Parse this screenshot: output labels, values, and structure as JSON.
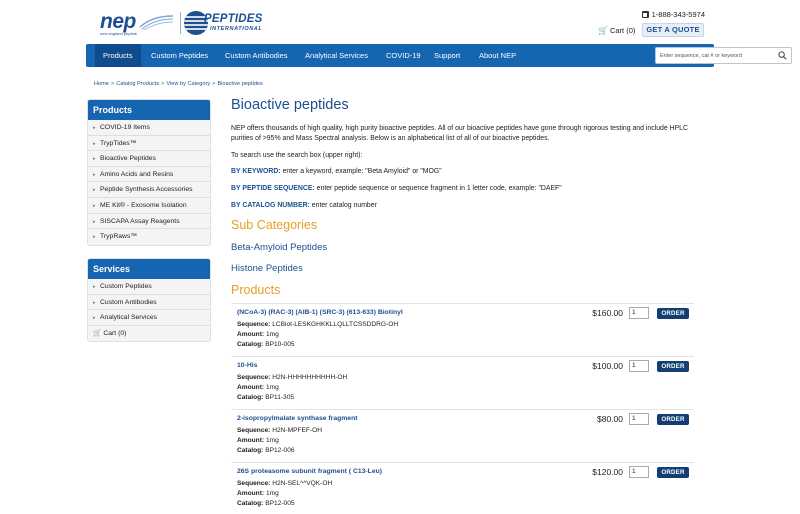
{
  "header": {
    "logo_nep": "nep",
    "logo_nep_sub": "new england peptide",
    "logo_pi": "PEPTIDES",
    "logo_pi_sub": "INTERNATIONAL",
    "phone": "1-888-343-5974",
    "cart": "Cart (0)",
    "quote_button": "GET A QUOTE"
  },
  "nav": {
    "items": [
      "Products",
      "Custom Peptides",
      "Custom Antibodies",
      "Analytical Services",
      "COVID-19",
      "Support",
      "About NEP"
    ],
    "search_placeholder": "Enter sequence, cat # or keyword"
  },
  "breadcrumb": [
    "Home",
    "Catalog Products",
    "View by Category",
    "Bioactive peptides"
  ],
  "sidebar": {
    "products_title": "Products",
    "products_items": [
      "COVID-19 Items",
      "TrypTides™",
      "Bioactive Peptides",
      "Amino Acids and Resins",
      "Peptide Synthesis Accessories",
      "ME Kit® - Exosome Isolation",
      "SISCAPA Assay Reagents",
      "TrypRaws™"
    ],
    "services_title": "Services",
    "services_items": [
      "Custom Peptides",
      "Custom Antibodies",
      "Analytical Services"
    ],
    "cart": "Cart (0)"
  },
  "main": {
    "title": "Bioactive peptides",
    "intro": "NEP offers thousands of high quality, high purity bioactive peptides.  All of our bioactive peptides have gone through rigorous testing and include HPLC purities of >95% and Mass Spectral analysis.  Below is an alphabetical list of all of our bioactive peptides.",
    "search_hint": "To search use the search box (upper right):",
    "hints": [
      {
        "label": "BY KEYWORD:",
        "text": " enter a keyword, example:  \"Beta Amyloid\" or \"MOG\""
      },
      {
        "label": "BY PEPTIDE SEQUENCE:",
        "text": "  enter peptide sequence or sequence fragment in 1 letter code, example:  \"DAEF\""
      },
      {
        "label": "BY CATALOG NUMBER:",
        "text": "  enter catalog number"
      }
    ],
    "subcategories_title": "Sub Categories",
    "subcategories": [
      "Beta-Amyloid Peptides",
      "Histone Peptides"
    ],
    "products_title": "Products",
    "seq_label": "Sequence:",
    "amount_label": "Amount:",
    "catalog_label": "Catalog:",
    "order_label": "ORDER",
    "products": [
      {
        "name": "(NCoA-3) (RAC-3) (AIB-1) (SRC-3) (613-633) Biotinyl",
        "sequence": "LCBiot-LESKGHKKLLQLLTCSSDDRG-OH",
        "amount": "1mg",
        "catalog": "BP10-005",
        "price": "$160.00",
        "qty": "1"
      },
      {
        "name": "10-His",
        "sequence": "H2N-HHHHHHHHHH-OH",
        "amount": "1mg",
        "catalog": "BP11-305",
        "price": "$100.00",
        "qty": "1"
      },
      {
        "name": "2-isopropylmalate synthase fragment",
        "sequence": "H2N-MPFEF-OH",
        "amount": "1mg",
        "catalog": "BP12-006",
        "price": "$80.00",
        "qty": "1"
      },
      {
        "name": "26S proteasome subunit fragment ( C13-Leu)",
        "sequence": "H2N-SEL^^VQK-OH",
        "amount": "1mg",
        "catalog": "BP12-005",
        "price": "$120.00",
        "qty": "1"
      }
    ]
  }
}
